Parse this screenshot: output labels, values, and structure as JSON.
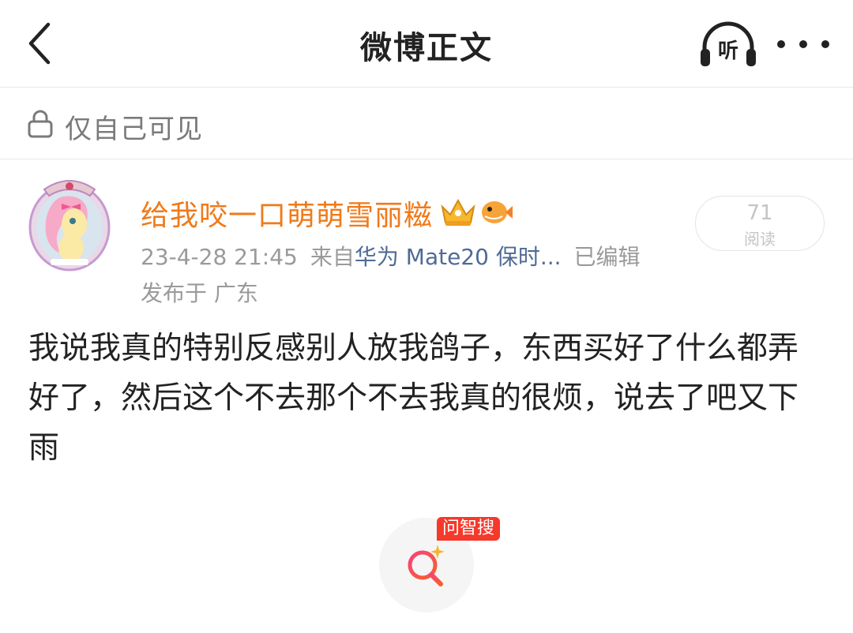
{
  "header": {
    "back_icon": "chevron-left-icon",
    "title": "微博正文",
    "listen_label": "听",
    "listen_icon": "headphones-icon",
    "more_icon": "more-horizontal-icon"
  },
  "visibility": {
    "icon": "lock-icon",
    "text": "仅自己可见"
  },
  "post": {
    "username": "给我咬一口萌萌雪丽糍",
    "username_color": "#f07a1a",
    "badges": [
      "crown-badge-icon",
      "pufferfish-badge-icon"
    ],
    "timestamp": "23-4-28 21:45",
    "source_prefix": "来自",
    "source_device": "华为 Mate20 保时...",
    "edited": "已编辑",
    "location": "发布于 广东",
    "reads_count": "71",
    "reads_label": "阅读",
    "text": "我说我真的特别反感别人放我鸽子，东西买好了什么都弄好了，然后这个不去那个不去我真的很烦，说去了吧又下雨"
  },
  "search_fab": {
    "tag": "问智搜",
    "icon": "ai-search-icon",
    "tag_color": "#f5392b"
  }
}
